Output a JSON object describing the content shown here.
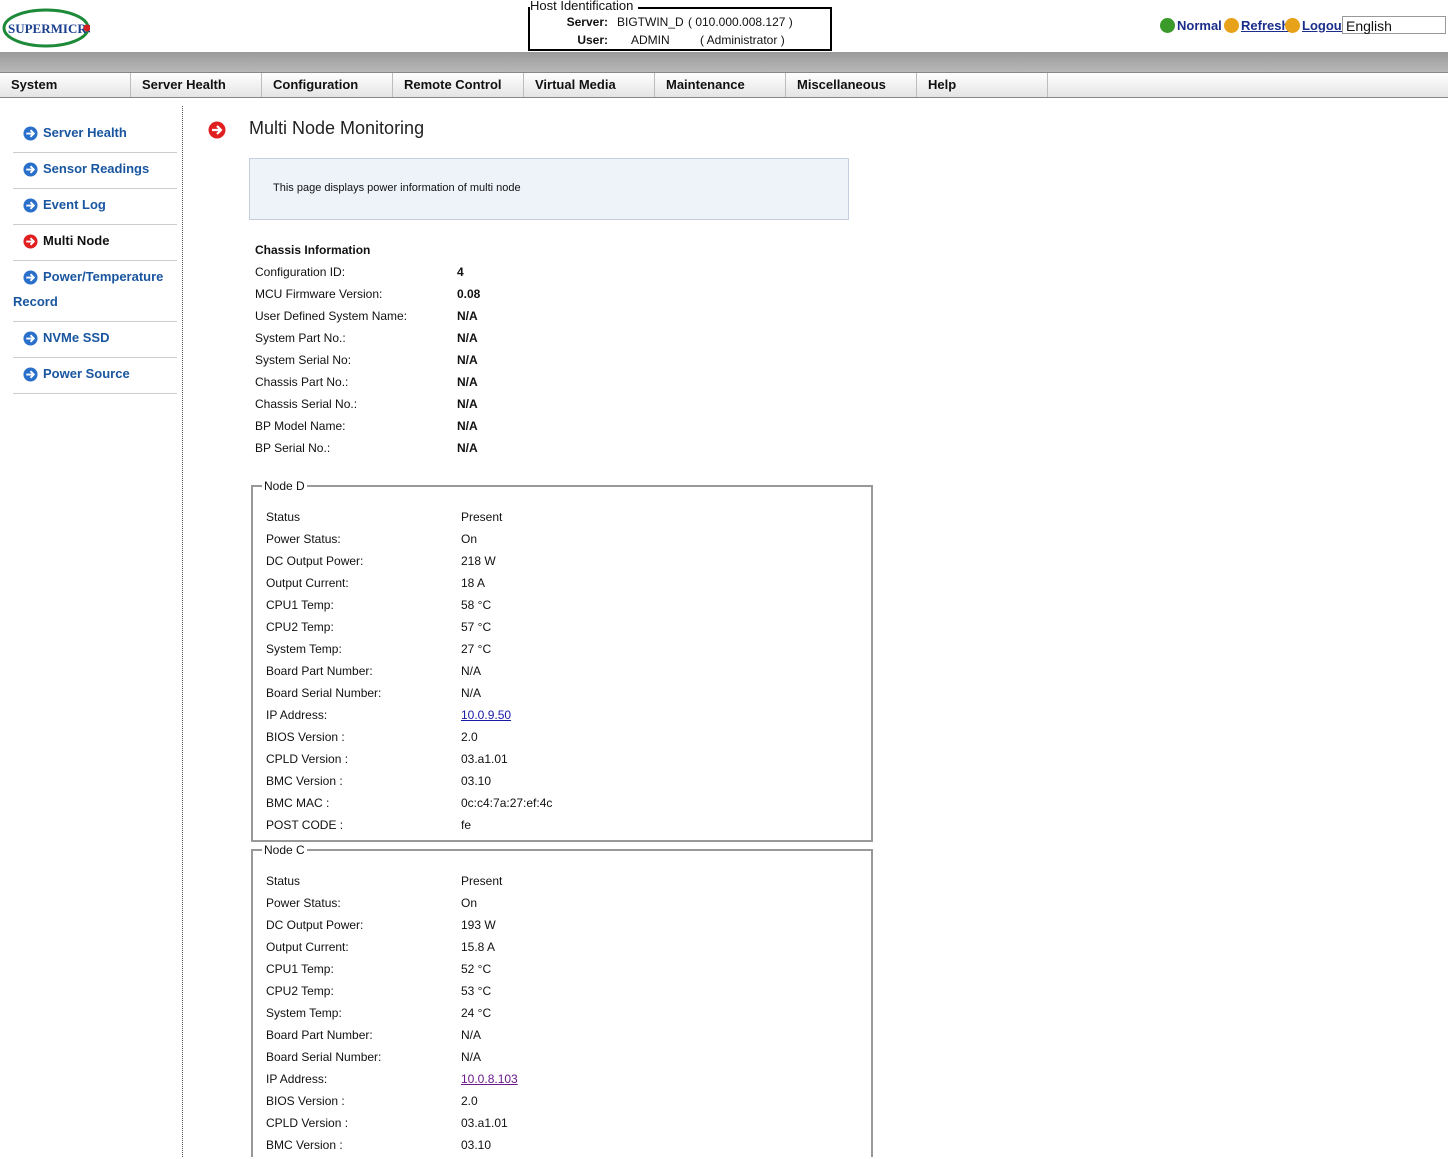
{
  "header": {
    "logo_text": "SUPERMICRO",
    "host_identification": {
      "legend": "Host Identification",
      "server_label": "Server:",
      "server_value": "BIGTWIN_D",
      "server_ip": "( 010.000.008.127 )",
      "user_label": "User:",
      "user_value": "ADMIN",
      "user_role": "( Administrator )"
    },
    "status_label": "Normal",
    "refresh_label": "Refresh",
    "logout_label": "Logout",
    "language": "English",
    "status_color": "#3a9a2a",
    "action_icon_color": "#e8a21a"
  },
  "menu": [
    "System",
    "Server Health",
    "Configuration",
    "Remote Control",
    "Virtual Media",
    "Maintenance",
    "Miscellaneous",
    "Help"
  ],
  "sidebar": {
    "items": [
      {
        "label": "Server Health",
        "icon": "blue-arrow-icon"
      },
      {
        "label": "Sensor Readings",
        "icon": "blue-arrow-icon"
      },
      {
        "label": "Event Log",
        "icon": "blue-arrow-icon"
      },
      {
        "label": "Multi Node",
        "icon": "red-arrow-icon",
        "active": true
      },
      {
        "label": "Power/Temperature",
        "label_line2": "Record",
        "icon": "blue-arrow-icon"
      },
      {
        "label": "NVMe SSD",
        "icon": "blue-arrow-icon"
      },
      {
        "label": "Power Source",
        "icon": "blue-arrow-icon"
      }
    ]
  },
  "page": {
    "title": "Multi Node Monitoring",
    "description": "This page displays power information of multi node"
  },
  "chassis": {
    "heading": "Chassis Information",
    "fields": [
      {
        "label": "Configuration ID:",
        "value": "4"
      },
      {
        "label": "MCU Firmware Version:",
        "value": "0.08"
      },
      {
        "label": "User Defined System Name:",
        "value": "N/A"
      },
      {
        "label": "System Part No.:",
        "value": "N/A"
      },
      {
        "label": "System Serial No:",
        "value": "N/A"
      },
      {
        "label": "Chassis Part No.:",
        "value": "N/A"
      },
      {
        "label": "Chassis Serial No.:",
        "value": "N/A"
      },
      {
        "label": "BP Model Name:",
        "value": "N/A"
      },
      {
        "label": "BP Serial No.:",
        "value": "N/A"
      }
    ]
  },
  "nodes": [
    {
      "legend": "Node D",
      "fields": [
        {
          "label": "Status",
          "value": "Present"
        },
        {
          "label": "Power Status:",
          "value": "On"
        },
        {
          "label": "DC Output Power:",
          "value": "218 W"
        },
        {
          "label": "Output Current:",
          "value": "18 A"
        },
        {
          "label": "CPU1 Temp:",
          "value": "58 °C"
        },
        {
          "label": "CPU2 Temp:",
          "value": "57 °C"
        },
        {
          "label": "System Temp:",
          "value": "27 °C"
        },
        {
          "label": "Board Part Number:",
          "value": "N/A"
        },
        {
          "label": "Board Serial Number:",
          "value": "N/A"
        },
        {
          "label": "IP Address:",
          "value": "10.0.9.50",
          "link": true
        },
        {
          "label": "BIOS Version :",
          "value": "2.0"
        },
        {
          "label": "CPLD Version :",
          "value": "03.a1.01"
        },
        {
          "label": "BMC Version :",
          "value": "03.10"
        },
        {
          "label": "BMC MAC :",
          "value": "0c:c4:7a:27:ef:4c"
        },
        {
          "label": "POST CODE :",
          "value": "fe"
        }
      ]
    },
    {
      "legend": "Node C",
      "fields": [
        {
          "label": "Status",
          "value": "Present"
        },
        {
          "label": "Power Status:",
          "value": "On"
        },
        {
          "label": "DC Output Power:",
          "value": "193 W"
        },
        {
          "label": "Output Current:",
          "value": "15.8 A"
        },
        {
          "label": "CPU1 Temp:",
          "value": "52 °C"
        },
        {
          "label": "CPU2 Temp:",
          "value": "53 °C"
        },
        {
          "label": "System Temp:",
          "value": "24 °C"
        },
        {
          "label": "Board Part Number:",
          "value": "N/A"
        },
        {
          "label": "Board Serial Number:",
          "value": "N/A"
        },
        {
          "label": "IP Address:",
          "value": "10.0.8.103",
          "link": true,
          "visited": true
        },
        {
          "label": "BIOS Version :",
          "value": "2.0"
        },
        {
          "label": "CPLD Version :",
          "value": "03.a1.01"
        },
        {
          "label": "BMC Version :",
          "value": "03.10"
        }
      ]
    }
  ]
}
